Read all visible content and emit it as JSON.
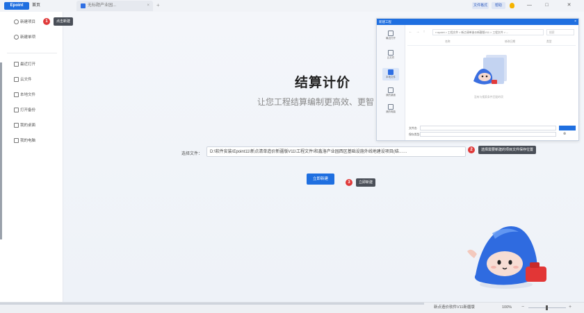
{
  "topbar": {
    "logo": "Epoint",
    "home_tab": "首页",
    "doc_tab": "无标题产业园...",
    "close_glyph": "×",
    "add_glyph": "+",
    "pill1": "文件格式",
    "pill2": "帮助",
    "icons": [
      "bulb-icon",
      "minimize-icon",
      "maximize-icon",
      "close-icon"
    ],
    "min_glyph": "—",
    "max_glyph": "□",
    "win_close_glyph": "✕"
  },
  "sidebar": {
    "new_project": "新建项目",
    "new_unit": "新建单项",
    "items": [
      "最近打开",
      "云文件",
      "本地文件",
      "打开备份",
      "我的桌面",
      "我的电脑"
    ]
  },
  "annotations": {
    "badge1": "1",
    "tip1": "点击新建",
    "badge2": "2",
    "tip2": "选择需要新建的项目文件保存位置",
    "badge3": "3",
    "tip3": "立即新建"
  },
  "main": {
    "title": "结算计价",
    "subtitle": "让您工程结算编制更高效、更智",
    "file_label": "选择文件：",
    "file_path": "D:\\软件安装\\Epoint11\\新点清单造价新疆版V11\\工程文件\\和鑫洛产业园西区基础设施外线地建设项目(结……",
    "create_button": "立即新建"
  },
  "dialog": {
    "title": "新建工程",
    "close": "×",
    "nav": "← → ↑",
    "path": "« epoint > 工程文件 > 新点清单造价新疆版V11 > 工程文件 > ...",
    "search": "搜索",
    "sidebar": [
      "最近打开",
      "云文件",
      "本地文件",
      "我的桌面",
      "我的电脑"
    ],
    "active_index": 2,
    "columns": [
      "名称",
      "修改日期",
      "类型"
    ],
    "empty_text": "没有与搜索条件匹配的项",
    "filename_label": "文件名:",
    "filetype_label": "保存类型:",
    "cancel_glyph": "⊗"
  },
  "statusbar": {
    "text": "新点造价软件V11新疆版",
    "zoom": "100%",
    "zoom_minus": "−",
    "zoom_plus": "+"
  }
}
